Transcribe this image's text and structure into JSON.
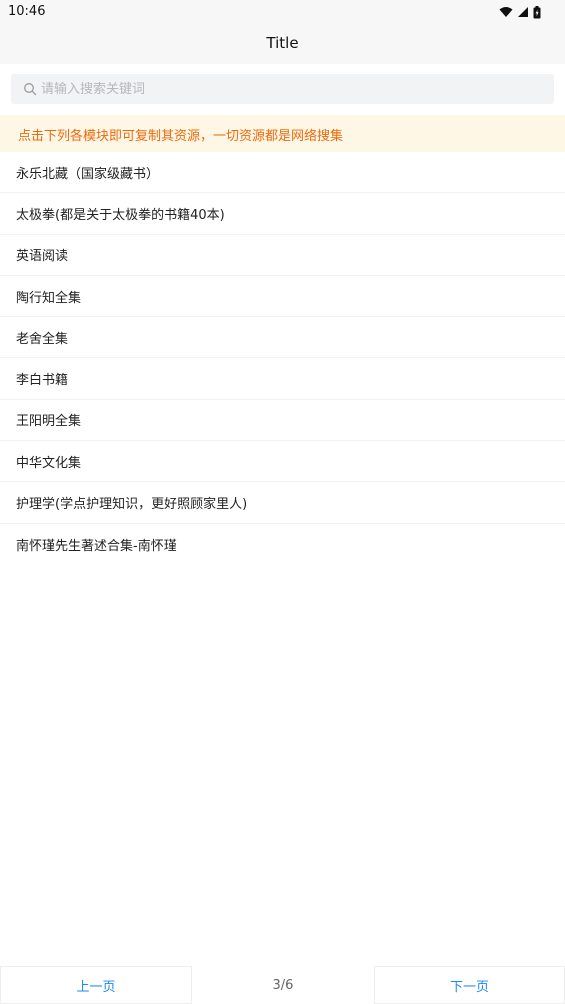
{
  "status_bar": {
    "time": "10:46",
    "icons": [
      "wifi-icon",
      "signal-icon",
      "battery-icon"
    ]
  },
  "nav": {
    "title": "Title"
  },
  "search": {
    "placeholder": "请输入搜索关键词",
    "value": ""
  },
  "notice": {
    "text": "点击下列各模块即可复制其资源，一切资源都是网络搜集"
  },
  "list": {
    "items": [
      "永乐北藏（国家级藏书）",
      "太极拳(都是关于太极拳的书籍40本)",
      "英语阅读",
      "陶行知全集",
      "老舍全集",
      "李白书籍",
      "王阳明全集",
      "中华文化集",
      "护理学(学点护理知识，更好照顾家里人)",
      "南怀瑾先生著述合集-南怀瑾"
    ]
  },
  "pagination": {
    "prev_label": "上一页",
    "next_label": "下一页",
    "page_text": "3/6"
  },
  "colors": {
    "accent": "#1989fa",
    "notice_text": "#ed6a0c",
    "notice_bg": "#fff7e6"
  }
}
